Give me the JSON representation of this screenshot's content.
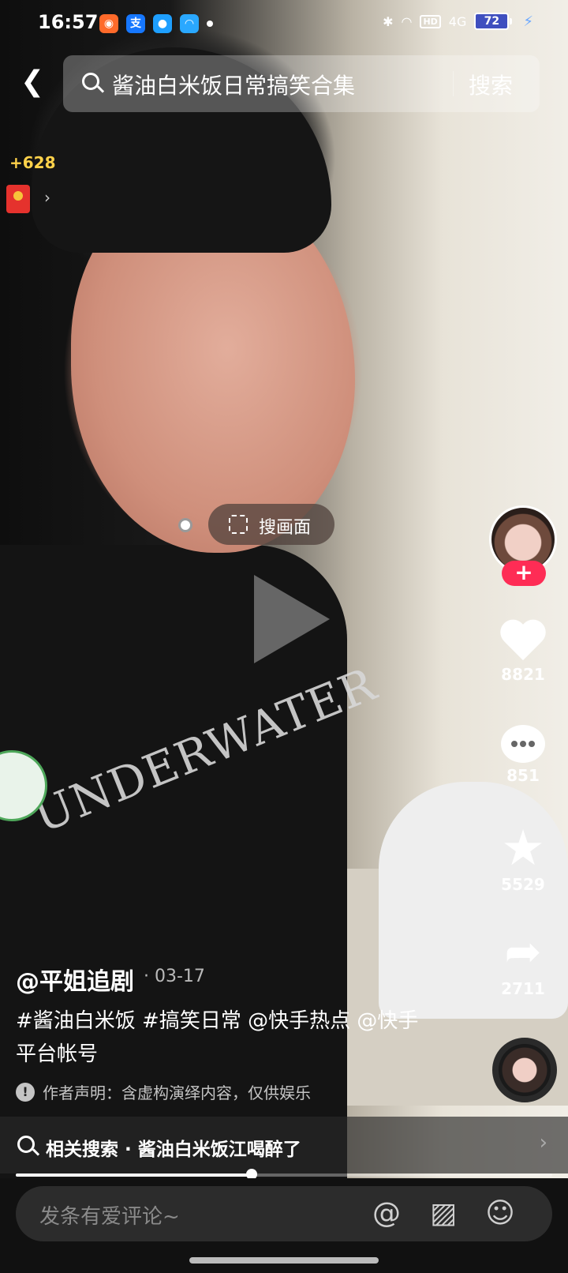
{
  "status_bar": {
    "time": "16:57",
    "network": "4G",
    "hd": "HD",
    "battery": "72"
  },
  "search": {
    "query": "酱油白米饭日常搞笑合集",
    "button": "搜索"
  },
  "reward": {
    "points": "+628"
  },
  "search_frame": {
    "label": "搜画面"
  },
  "actions": {
    "likes": "8821",
    "comments": "851",
    "favorites": "5529",
    "shares": "2711"
  },
  "post": {
    "author": "@平姐追剧",
    "date": "· 03-17",
    "description": "#酱油白米饭 #搞笑日常 @快手热点 @快手平台帐号",
    "disclaimer": "作者声明：含虚构演绎内容，仅供娱乐"
  },
  "related": {
    "text": "相关搜索 · 酱油白米饭江喝醉了"
  },
  "video_text": {
    "shirt": "UNDERWATER"
  },
  "progress": {
    "fraction": 0.44
  },
  "comment": {
    "placeholder": "发条有爱评论~"
  },
  "icons": {
    "back": "chevron-left",
    "search": "magnifier",
    "like": "heart",
    "comment": "chat-bubble",
    "favorite": "star",
    "share": "share-arrow",
    "mention": "at-sign",
    "image": "image",
    "emoji": "smiley"
  }
}
